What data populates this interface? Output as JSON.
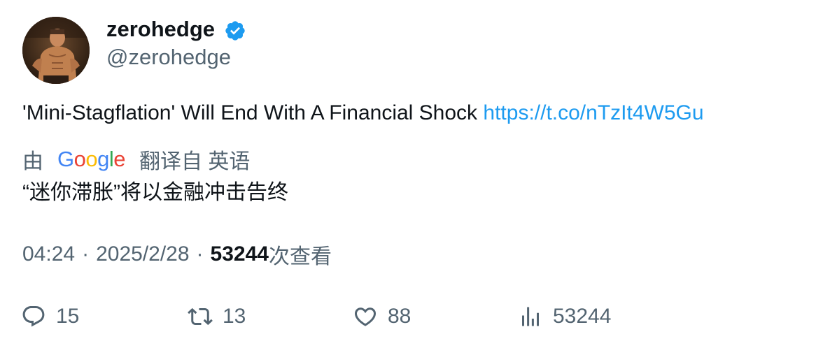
{
  "user": {
    "display_name": "zerohedge",
    "handle": "@zerohedge",
    "verified": true
  },
  "tweet": {
    "text": "'Mini-Stagflation' Will End With A Financial Shock",
    "link": "https://t.co/nTzIt4W5Gu"
  },
  "translation": {
    "by_label": "由",
    "provider": "Google",
    "from_label": "翻译自 英语",
    "text": "“迷你滞胀”将以金融冲击告终"
  },
  "meta": {
    "time": "04:24",
    "separator": "·",
    "date": "2025/2/28",
    "views_count": "53244",
    "views_label": "次查看"
  },
  "actions": {
    "reply_count": "15",
    "retweet_count": "13",
    "like_count": "88",
    "views_count": "53244"
  },
  "colors": {
    "link": "#1d9bf0",
    "verified": "#1d9bf0",
    "secondary_text": "#536471",
    "primary_text": "#0f1419",
    "google_blue": "#4285F4",
    "google_red": "#EA4335",
    "google_yellow": "#FBBC05",
    "google_green": "#34A853"
  }
}
